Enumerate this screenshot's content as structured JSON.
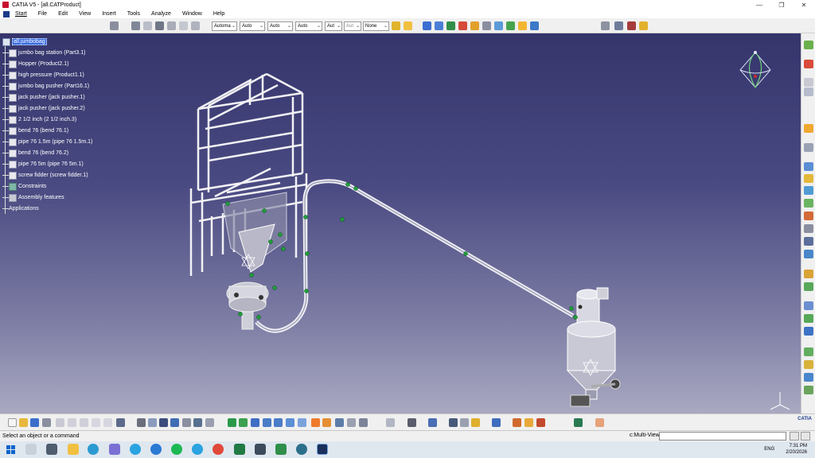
{
  "window": {
    "title": "CATIA V5 - [all.CATProduct]",
    "controls": [
      "—",
      "❐",
      "✕"
    ]
  },
  "menu": {
    "items": [
      "Start",
      "File",
      "Edit",
      "View",
      "Insert",
      "Tools",
      "Analyze",
      "Window",
      "Help"
    ]
  },
  "toolbar": {
    "dropdowns": [
      "Automa",
      "Auto",
      "Auto",
      "Auto",
      "Aut",
      "Aut",
      "None"
    ]
  },
  "tree": {
    "root": "all.jumbobag",
    "items": [
      {
        "label": "jumbo bag station (Part3.1)",
        "type": "part"
      },
      {
        "label": "Hopper (Product2.1)",
        "type": "product"
      },
      {
        "label": "high pressure (Product1.1)",
        "type": "product"
      },
      {
        "label": "jumbo bag pusher (Part16.1)",
        "type": "part"
      },
      {
        "label": "jack pusher (jack pusher.1)",
        "type": "part"
      },
      {
        "label": "jack pusher (jack pusher.2)",
        "type": "part"
      },
      {
        "label": "2 1/2 inch (2 1/2 inch.3)",
        "type": "part"
      },
      {
        "label": "bend 76 (bend 76.1)",
        "type": "part"
      },
      {
        "label": "pipe 76 1.5m (pipe 76 1.5m.1)",
        "type": "part"
      },
      {
        "label": "bend 76 (bend 76.2)",
        "type": "part"
      },
      {
        "label": "pipe 76 5m (pipe 76 5m.1)",
        "type": "part"
      },
      {
        "label": "screw fidder (screw fidder.1)",
        "type": "part"
      },
      {
        "label": "Constraints",
        "type": "constraints"
      },
      {
        "label": "Assembly features",
        "type": "features"
      },
      {
        "label": "Applications",
        "type": "applications"
      }
    ]
  },
  "status": {
    "message": "Select an object or a command",
    "command_label": "c:Multi-View",
    "command_value": ""
  },
  "taskbar": {
    "language": "ENG",
    "time": "7:31 PM",
    "date": "2/20/2026"
  },
  "brand": {
    "logo_text": "CATIA"
  },
  "colors": {
    "accent": "#3a6de0",
    "viewport_top": "#35356c",
    "viewport_bottom": "#a9a9c2"
  }
}
